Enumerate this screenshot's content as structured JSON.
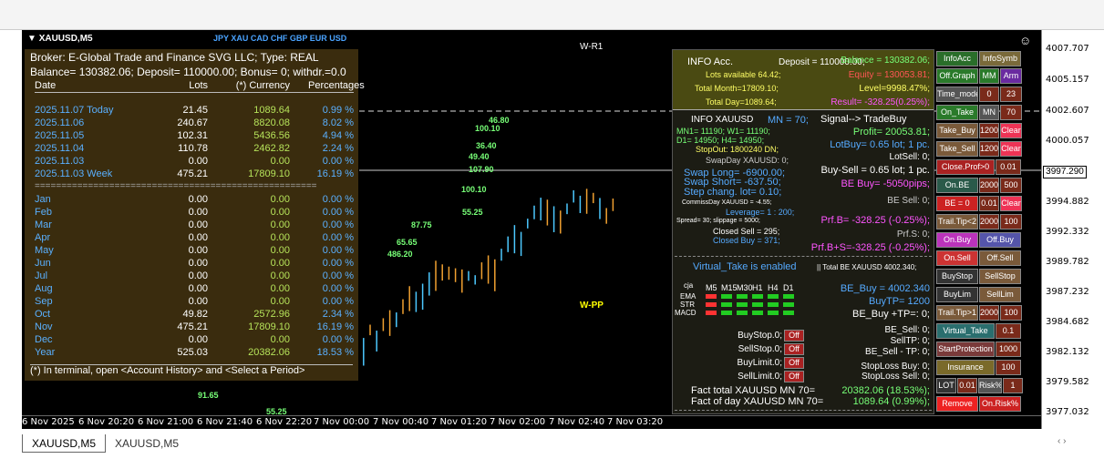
{
  "symbol": "XAUUSD,M5",
  "currencies": "JPY XAU CAD CHF GBP EUR USD",
  "wlabels": {
    "r1": "W-R1",
    "pp": "W-PP"
  },
  "price_axis": [
    "4007.707",
    "4005.157",
    "4002.607",
    "4000.057",
    "3997.290",
    "3994.882",
    "3992.332",
    "3989.782",
    "3987.232",
    "3984.682",
    "3982.132",
    "3979.582",
    "3977.032"
  ],
  "time_axis": [
    "6 Nov 2025",
    "6 Nov 20:20",
    "6 Nov 21:00",
    "6 Nov 21:40",
    "6 Nov 22:20",
    "7 Nov 00:00",
    "7 Nov 00:40",
    "7 Nov 01:20",
    "7 Nov 02:00",
    "7 Nov 02:40",
    "7 Nov 03:20"
  ],
  "tabs": [
    "XAUUSD,M5",
    "XAUUSD,M5"
  ],
  "panel1": {
    "broker": "Broker: E-Global Trade and Finance SVG LLC;  Type:  REAL",
    "balance_line": "Balance= 130382.06; Deposit= 110000.00; Bonus= 0; withdr.=0.0",
    "headers": [
      "Date",
      "Lots",
      "(*) Currency",
      "Percentages"
    ],
    "days": [
      [
        "2025.11.07 Today",
        "21.45",
        "1089.64",
        "0.99 %"
      ],
      [
        "2025.11.06",
        "240.67",
        "8820.08",
        "8.02 %"
      ],
      [
        "2025.11.05",
        "102.31",
        "5436.56",
        "4.94 %"
      ],
      [
        "2025.11.04",
        "110.78",
        "2462.82",
        "2.24 %"
      ],
      [
        "2025.11.03",
        "0.00",
        "0.00",
        "0.00 %"
      ],
      [
        "2025.11.03 Week",
        "475.21",
        "17809.10",
        "16.19 %"
      ]
    ],
    "sep": "=====================================================",
    "months": [
      [
        "Jan",
        "0.00",
        "0.00",
        "0.00 %"
      ],
      [
        "Feb",
        "0.00",
        "0.00",
        "0.00 %"
      ],
      [
        "Mar",
        "0.00",
        "0.00",
        "0.00 %"
      ],
      [
        "Apr",
        "0.00",
        "0.00",
        "0.00 %"
      ],
      [
        "May",
        "0.00",
        "0.00",
        "0.00 %"
      ],
      [
        "Jun",
        "0.00",
        "0.00",
        "0.00 %"
      ],
      [
        "Jul",
        "0.00",
        "0.00",
        "0.00 %"
      ],
      [
        "Aug",
        "0.00",
        "0.00",
        "0.00 %"
      ],
      [
        "Sep",
        "0.00",
        "0.00",
        "0.00 %"
      ],
      [
        "Oct",
        "49.82",
        "2572.96",
        "2.34 %"
      ],
      [
        "Nov",
        "475.21",
        "17809.10",
        "16.19 %"
      ],
      [
        "Dec",
        "0.00",
        "0.00",
        "0.00 %"
      ],
      [
        "Year",
        "525.03",
        "20382.06",
        "18.53 %"
      ]
    ],
    "note": "(*) In terminal, open <Account History> and <Select a Period>"
  },
  "chart_labels": [
    "100.10",
    "46.80",
    "36.40",
    "49.40",
    "107.90",
    "100.10",
    "55.25",
    "87.75",
    "65.65",
    "486.20",
    "91.65",
    "55.25"
  ],
  "panel2": {
    "info_acc": "INFO Acc.",
    "deposit": "Deposit = 110000.00;",
    "balance": "Balance = 130382.06;",
    "lots_avail": "Lots available 64.42;",
    "equity": "Equity = 130053.81;",
    "total_month": "Total Month=17809.10;",
    "level": "Level=9998.47%;",
    "total_day": "Total Day=1089.64;",
    "result": "Result= -328.25(0.25%);",
    "info_sym": "INFO XAUUSD",
    "mn": "MN = 70;",
    "signal": "Signal-->  TradeBuy",
    "mn1": "MN1= 11190;  W1= 11190;",
    "profit": "Profit= 20053.81;",
    "d1": "D1= 14950;  H4= 14950;",
    "lotbuy": "LotBuy= 0.65 lot; 1 pc.",
    "stopout": "StopOut: 1800240 DN;",
    "lotsell": "LotSell: 0;",
    "swapday": "SwapDay XAUUSD: 0;",
    "buysell": "Buy-Sell = 0.65 lot; 1 pc.",
    "swaplong": "Swap Long= -6900.00;",
    "swapshort": "Swap Short= -637.50;",
    "bebuy": "BE Buy= -5050pips;",
    "stepchang": "Step chang. lot= 0.10;",
    "besell": "BE Sell: 0;",
    "commiss": "CommissDay XAUUSD = -4.55;",
    "leverage": "Leverage= 1 : 200;",
    "prfb": "Prf.B= -328.25 (-0.25%);",
    "spread": "Spread= 30; slippage = 5000;",
    "closedsell": "Closed  Sell = 295;",
    "prfs": "Prf.S: 0;",
    "closedbuy": "Closed Buy = 371;",
    "prfbs": "Prf.B+S=-328.25 (-0.25%);",
    "vtake": "Virtual_Take is enabled",
    "totalbe": "|| Total BE XAUUSD  4002.340;",
    "tf": [
      "M5",
      "M15",
      "M30",
      "H1",
      "H4",
      "D1"
    ],
    "ind": [
      "EMA",
      "STR",
      "MACD"
    ],
    "cja": "cja",
    "be_buy": "BE_Buy = 4002.340",
    "buytp": "BuyTP= 1200",
    "be_buy_tp": "BE_Buy +TP=: 0;",
    "be_sell": "BE_Sell: 0;",
    "selltp": "SellTP: 0;",
    "be_sell_tp": "BE_Sell - TP: 0;",
    "buystop": "BuyStop.0;",
    "sellstop": "SellStop.0;",
    "buylimit": "BuyLimit.0;",
    "selllimit": "SellLimit.0;",
    "off": "Off",
    "slbuy": "StopLoss Buy: 0;",
    "slsell": "StopLoss Sell: 0;",
    "fact_total": "Fact total    XAUUSD MN 70=",
    "fact_total_v": "20382.06 (18.53%);",
    "fact_day": "Fact of day XAUUSD MN 70=",
    "fact_day_v": "1089.64 (0.99%);"
  },
  "buttons": [
    [
      "InfoAcc",
      "InfoSymb"
    ],
    [
      "Off.Graph",
      "MM",
      "Arm"
    ],
    [
      "Time_mode",
      "0",
      "23"
    ],
    [
      "On_Take",
      "MN",
      "70"
    ],
    [
      "Take_Buy",
      "1200",
      "Clear"
    ],
    [
      "Take_Sell",
      "1200",
      "Clear"
    ],
    [
      "Close.Prof>0",
      "0.01"
    ],
    [
      "On.BE",
      "2000",
      "500"
    ],
    [
      "BE = 0",
      "0.01",
      "Clear"
    ],
    [
      "Trail.Tip<2",
      "2000",
      "100"
    ],
    [
      "On.Buy",
      "Off.Buy"
    ],
    [
      "On.Sell",
      "Off.Sell"
    ],
    [
      "BuyStop",
      "SellStop"
    ],
    [
      "BuyLim",
      "SellLim"
    ],
    [
      "Trail.Tip>1",
      "2000",
      "100"
    ],
    [
      "Virtual_Take",
      "0.1"
    ],
    [
      "StartProtection",
      "1000"
    ],
    [
      "Insurance",
      "100"
    ],
    [
      "LOT",
      "0.01",
      "Risk%",
      "1"
    ],
    [
      "Remove",
      "On.Risk%"
    ]
  ]
}
